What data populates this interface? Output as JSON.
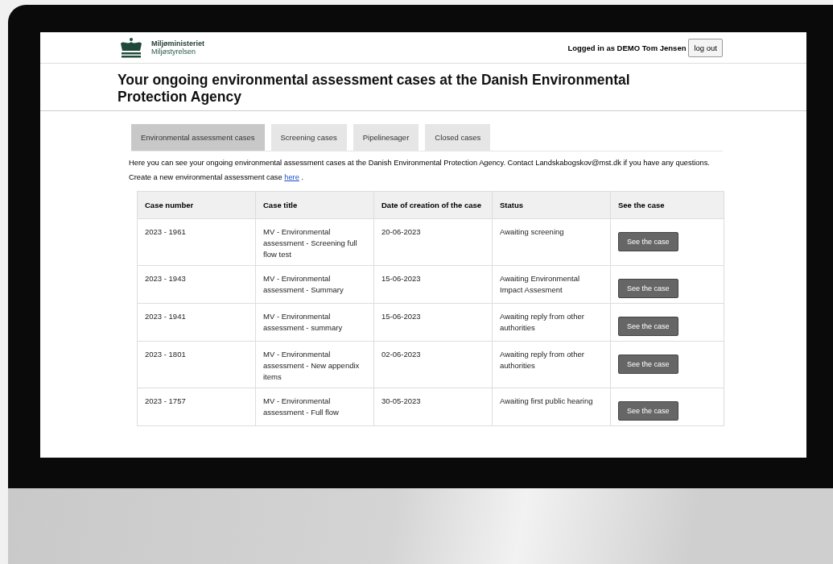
{
  "header": {
    "logo_title": "Miljøministeriet",
    "logo_subtitle": "Miljøstyrelsen",
    "login_text": "Logged in as DEMO Tom Jensen",
    "logout_button": "log out"
  },
  "title": "Your ongoing environmental assessment cases at the Danish Environmental Protection Agency",
  "tabs": [
    {
      "label": "Environmental assessment cases",
      "selected": true
    },
    {
      "label": "Screening cases",
      "selected": false
    },
    {
      "label": "Pipelinesager",
      "selected": false
    },
    {
      "label": "Closed cases",
      "selected": false
    }
  ],
  "intro": "Here you can see your ongoing environmental assessment cases at the Danish Environmental Protection Agency. Contact Landskabogskov@mst.dk if you have any questions.",
  "create_text": "Create a new environmental assessment case",
  "create_link": "here",
  "create_end": ".",
  "table": {
    "columns": [
      "Case number",
      "Case title",
      "Date of creation of the case",
      "Status",
      "See the case"
    ],
    "rows": [
      {
        "number": "2023 - 1961",
        "title": "MV - Environmental assessment - Screening full flow test",
        "date": "20-06-2023",
        "status": "Awaiting screening",
        "button": "See the case"
      },
      {
        "number": "2023 - 1943",
        "title": "MV - Environmental assessment - Summary",
        "date": "15-06-2023",
        "status": "Awaiting Environmental Impact Assesment",
        "button": "See the case"
      },
      {
        "number": "2023 - 1941",
        "title": "MV - Environmental assessment - summary",
        "date": "15-06-2023",
        "status": "Awaiting reply from other authorities",
        "button": "See the case"
      },
      {
        "number": "2023 - 1801",
        "title": "MV - Environmental assessment - New appendix items",
        "date": "02-06-2023",
        "status": "Awaiting reply from other authorities",
        "button": "See the case"
      },
      {
        "number": "2023 - 1757",
        "title": "MV - Environmental assessment - Full flow",
        "date": "30-05-2023",
        "status": "Awaiting first public hearing",
        "button": "See the case"
      }
    ]
  }
}
